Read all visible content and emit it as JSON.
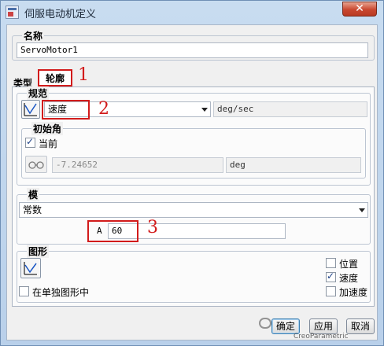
{
  "window": {
    "title": "伺服电动机定义",
    "close_glyph": "✕"
  },
  "name_group": {
    "label": "名称",
    "value": "ServoMotor1"
  },
  "tabs": [
    {
      "label": "类型"
    },
    {
      "label": "轮廓"
    }
  ],
  "spec_group": {
    "label": "规范",
    "dropdown_value": "速度",
    "unit": "deg/sec"
  },
  "initial_angle_group": {
    "label": "初始角",
    "current_label": "当前",
    "current_checked": true,
    "value": "-7.24652",
    "unit": "deg"
  },
  "module_group": {
    "label": "模",
    "dropdown_value": "常数",
    "coef_label": "A",
    "coef_value": "60"
  },
  "graph_group": {
    "label": "图形",
    "separate_graph_label": "在单独图形中",
    "options": [
      {
        "label": "位置",
        "checked": false
      },
      {
        "label": "速度",
        "checked": true
      },
      {
        "label": "加速度",
        "checked": false
      }
    ]
  },
  "annotations": [
    "1",
    "2",
    "3"
  ],
  "buttons": {
    "ok": "确定",
    "apply": "应用",
    "cancel": "取消"
  },
  "watermark": "CreoParametric"
}
